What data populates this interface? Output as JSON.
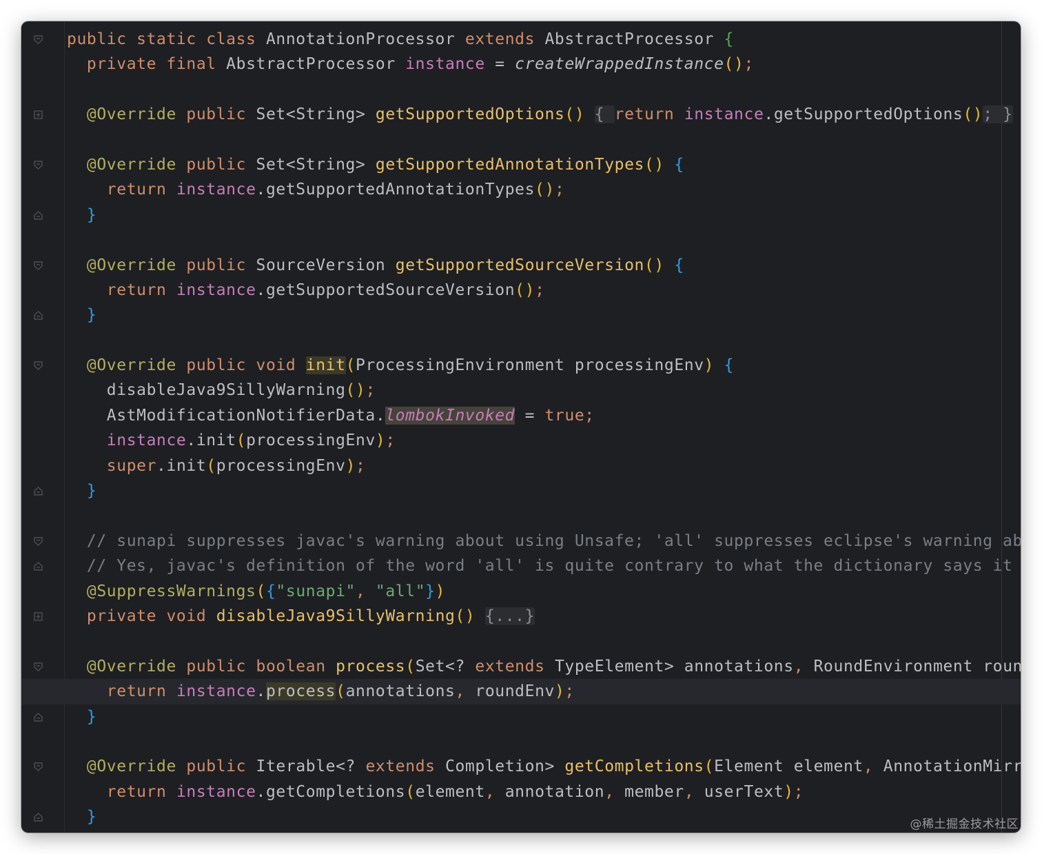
{
  "editor": {
    "language": "Java",
    "theme": "dark",
    "background": "#1e1f22",
    "colors": {
      "keyword": "#cf8e6d",
      "annotation": "#b3ae60",
      "method_declaration": "#e7c06a",
      "field": "#c77dbb",
      "string": "#6aab73",
      "comment": "#7a7e85",
      "default_text": "#bcbec4"
    },
    "lines": [
      {
        "fold": "open",
        "segs": [
          [
            "kw",
            "public static class "
          ],
          [
            "t",
            "AnnotationProcessor "
          ],
          [
            "kw",
            "extends "
          ],
          [
            "t",
            "AbstractProcessor "
          ],
          [
            "br2",
            "{"
          ]
        ]
      },
      {
        "fold": "",
        "segs": [
          [
            "t",
            "  "
          ],
          [
            "kw",
            "private final "
          ],
          [
            "t",
            "AbstractProcessor "
          ],
          [
            "field",
            "instance"
          ],
          [
            "t",
            " = "
          ],
          [
            "ital",
            "createWrappedInstance"
          ],
          [
            "br1",
            "()"
          ],
          [
            "kw",
            ";"
          ]
        ]
      },
      {
        "fold": "",
        "segs": []
      },
      {
        "fold": "collapsed",
        "segs": [
          [
            "t",
            "  "
          ],
          [
            "ann",
            "@Override "
          ],
          [
            "kw",
            "public "
          ],
          [
            "t",
            "Set<String> "
          ],
          [
            "decl",
            "getSupportedOptions"
          ],
          [
            "br1",
            "()"
          ],
          [
            "t",
            " "
          ],
          [
            "foldbg",
            "{ "
          ],
          [
            "kw",
            "return "
          ],
          [
            "field",
            "instance"
          ],
          [
            "t",
            ".getSupportedOptions"
          ],
          [
            "br1",
            "()"
          ],
          [
            "foldbg",
            "; }"
          ]
        ]
      },
      {
        "fold": "",
        "segs": []
      },
      {
        "fold": "open",
        "segs": [
          [
            "t",
            "  "
          ],
          [
            "ann",
            "@Override "
          ],
          [
            "kw",
            "public "
          ],
          [
            "t",
            "Set<String> "
          ],
          [
            "decl",
            "getSupportedAnnotationTypes"
          ],
          [
            "br1",
            "()"
          ],
          [
            "t",
            " "
          ],
          [
            "br3",
            "{"
          ]
        ]
      },
      {
        "fold": "",
        "segs": [
          [
            "t",
            "    "
          ],
          [
            "kw",
            "return "
          ],
          [
            "field",
            "instance"
          ],
          [
            "t",
            ".getSupportedAnnotationTypes"
          ],
          [
            "br1",
            "()"
          ],
          [
            "kw",
            ";"
          ]
        ]
      },
      {
        "fold": "end",
        "segs": [
          [
            "t",
            "  "
          ],
          [
            "br3",
            "}"
          ]
        ]
      },
      {
        "fold": "",
        "segs": []
      },
      {
        "fold": "open",
        "segs": [
          [
            "t",
            "  "
          ],
          [
            "ann",
            "@Override "
          ],
          [
            "kw",
            "public "
          ],
          [
            "t",
            "SourceVersion "
          ],
          [
            "decl",
            "getSupportedSourceVersion"
          ],
          [
            "br1",
            "()"
          ],
          [
            "t",
            " "
          ],
          [
            "br3",
            "{"
          ]
        ]
      },
      {
        "fold": "",
        "segs": [
          [
            "t",
            "    "
          ],
          [
            "kw",
            "return "
          ],
          [
            "field",
            "instance"
          ],
          [
            "t",
            ".getSupportedSourceVersion"
          ],
          [
            "br1",
            "()"
          ],
          [
            "kw",
            ";"
          ]
        ]
      },
      {
        "fold": "end",
        "segs": [
          [
            "t",
            "  "
          ],
          [
            "br3",
            "}"
          ]
        ]
      },
      {
        "fold": "",
        "segs": []
      },
      {
        "fold": "open",
        "segs": [
          [
            "t",
            "  "
          ],
          [
            "ann",
            "@Override "
          ],
          [
            "kw",
            "public void "
          ],
          [
            "declhl",
            "init"
          ],
          [
            "br1",
            "("
          ],
          [
            "t",
            "ProcessingEnvironment processingEnv"
          ],
          [
            "br1",
            ")"
          ],
          [
            "t",
            " "
          ],
          [
            "br3",
            "{"
          ]
        ]
      },
      {
        "fold": "",
        "segs": [
          [
            "t",
            "    disableJava9SillyWarning"
          ],
          [
            "br1",
            "()"
          ],
          [
            "kw",
            ";"
          ]
        ]
      },
      {
        "fold": "",
        "segs": [
          [
            "t",
            "    AstModificationNotifierData."
          ],
          [
            "fieldhl",
            "lombokInvoked"
          ],
          [
            "t",
            " = "
          ],
          [
            "kw",
            "true;"
          ]
        ]
      },
      {
        "fold": "",
        "segs": [
          [
            "t",
            "    "
          ],
          [
            "field",
            "instance"
          ],
          [
            "t",
            ".init"
          ],
          [
            "br1",
            "("
          ],
          [
            "t",
            "processingEnv"
          ],
          [
            "br1",
            ")"
          ],
          [
            "kw",
            ";"
          ]
        ]
      },
      {
        "fold": "",
        "segs": [
          [
            "t",
            "    "
          ],
          [
            "kw",
            "super"
          ],
          [
            "t",
            ".init"
          ],
          [
            "br1",
            "("
          ],
          [
            "t",
            "processingEnv"
          ],
          [
            "br1",
            ")"
          ],
          [
            "kw",
            ";"
          ]
        ]
      },
      {
        "fold": "end",
        "segs": [
          [
            "t",
            "  "
          ],
          [
            "br3",
            "}"
          ]
        ]
      },
      {
        "fold": "",
        "segs": []
      },
      {
        "fold": "open",
        "segs": [
          [
            "t",
            "  "
          ],
          [
            "cmt",
            "// sunapi suppresses javac's warning about using Unsafe; 'all' suppresses eclipse's warning about"
          ]
        ]
      },
      {
        "fold": "end",
        "segs": [
          [
            "t",
            "  "
          ],
          [
            "cmt",
            "// Yes, javac's definition of the word 'all' is quite contrary to what the dictionary says it mean"
          ]
        ]
      },
      {
        "fold": "",
        "segs": [
          [
            "t",
            "  "
          ],
          [
            "ann",
            "@SuppressWarnings"
          ],
          [
            "br1",
            "("
          ],
          [
            "br3",
            "{"
          ],
          [
            "str",
            "\"sunapi\""
          ],
          [
            "kw",
            ", "
          ],
          [
            "str",
            "\"all\""
          ],
          [
            "br3",
            "}"
          ],
          [
            "br1",
            ")"
          ]
        ]
      },
      {
        "fold": "collapsed",
        "segs": [
          [
            "t",
            "  "
          ],
          [
            "kw",
            "private void "
          ],
          [
            "decl",
            "disableJava9SillyWarning"
          ],
          [
            "br1",
            "()"
          ],
          [
            "t",
            " "
          ],
          [
            "foldbg",
            "{...}"
          ]
        ]
      },
      {
        "fold": "",
        "segs": []
      },
      {
        "fold": "open",
        "segs": [
          [
            "t",
            "  "
          ],
          [
            "ann",
            "@Override "
          ],
          [
            "kw",
            "public boolean "
          ],
          [
            "decl",
            "process"
          ],
          [
            "br1",
            "("
          ],
          [
            "t",
            "Set<? "
          ],
          [
            "kw",
            "extends "
          ],
          [
            "t",
            "TypeElement> annotations"
          ],
          [
            "kw",
            ", "
          ],
          [
            "t",
            "RoundEnvironment roundEnv"
          ]
        ]
      },
      {
        "fold": "",
        "hl": true,
        "segs": [
          [
            "t",
            "    "
          ],
          [
            "kw",
            "return "
          ],
          [
            "field",
            "instance"
          ],
          [
            "t",
            "."
          ],
          [
            "mhl",
            "process"
          ],
          [
            "br1",
            "("
          ],
          [
            "t",
            "annotations"
          ],
          [
            "kw",
            ", "
          ],
          [
            "t",
            "roundEnv"
          ],
          [
            "br1",
            ")"
          ],
          [
            "kw",
            ";"
          ]
        ]
      },
      {
        "fold": "end",
        "segs": [
          [
            "t",
            "  "
          ],
          [
            "br3",
            "}"
          ]
        ]
      },
      {
        "fold": "",
        "segs": []
      },
      {
        "fold": "open",
        "segs": [
          [
            "t",
            "  "
          ],
          [
            "ann",
            "@Override "
          ],
          [
            "kw",
            "public "
          ],
          [
            "t",
            "Iterable<? "
          ],
          [
            "kw",
            "extends "
          ],
          [
            "t",
            "Completion> "
          ],
          [
            "decl",
            "getCompletions"
          ],
          [
            "br1",
            "("
          ],
          [
            "t",
            "Element element"
          ],
          [
            "kw",
            ", "
          ],
          [
            "t",
            "AnnotationMirror a"
          ]
        ]
      },
      {
        "fold": "",
        "segs": [
          [
            "t",
            "    "
          ],
          [
            "kw",
            "return "
          ],
          [
            "field",
            "instance"
          ],
          [
            "t",
            ".getCompletions"
          ],
          [
            "br1",
            "("
          ],
          [
            "t",
            "element"
          ],
          [
            "kw",
            ", "
          ],
          [
            "t",
            "annotation"
          ],
          [
            "kw",
            ", "
          ],
          [
            "t",
            "member"
          ],
          [
            "kw",
            ", "
          ],
          [
            "t",
            "userText"
          ],
          [
            "br1",
            ")"
          ],
          [
            "kw",
            ";"
          ]
        ]
      },
      {
        "fold": "end",
        "segs": [
          [
            "t",
            "  "
          ],
          [
            "br3",
            "}"
          ]
        ]
      }
    ]
  },
  "watermark": "@稀土掘金技术社区"
}
